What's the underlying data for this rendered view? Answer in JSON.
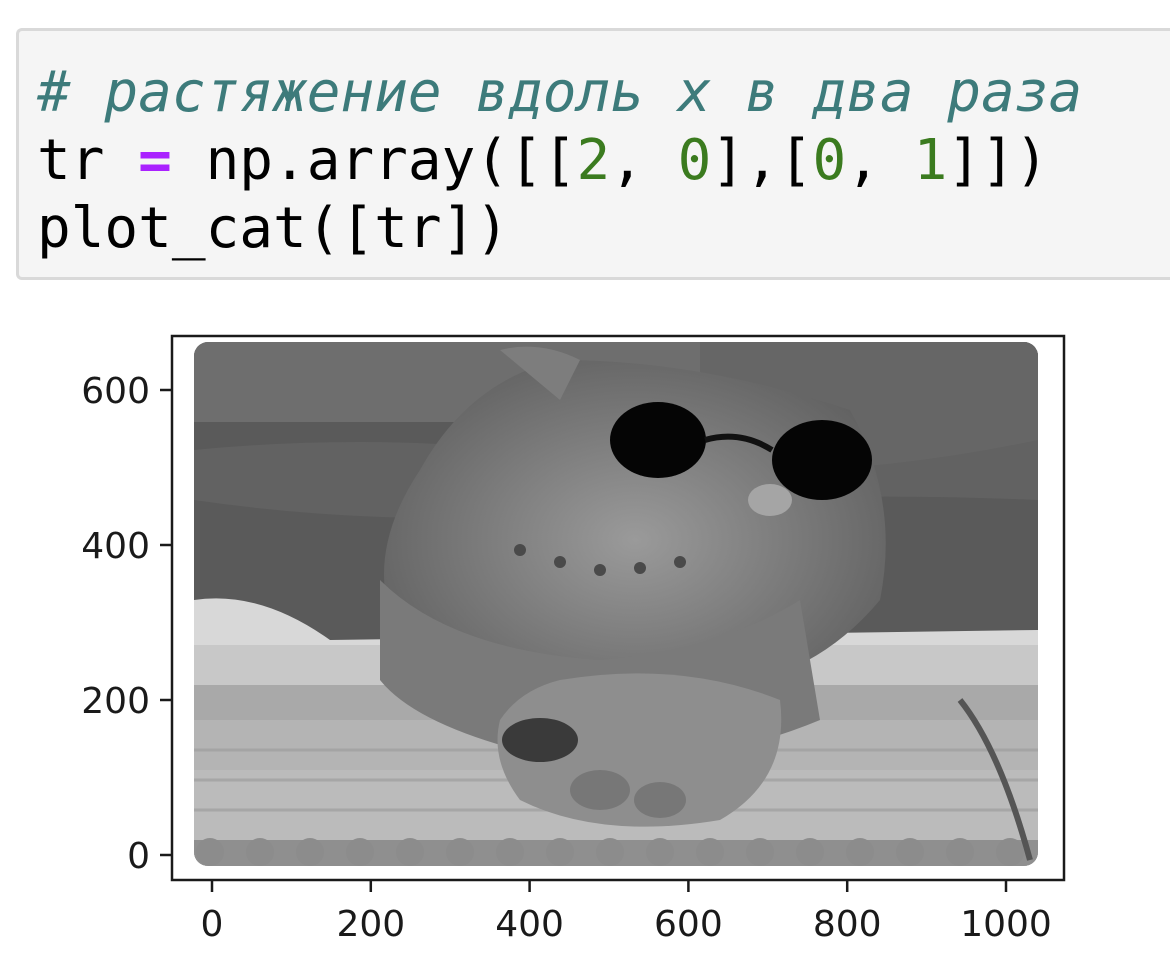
{
  "code_cell": {
    "lines": [
      [
        {
          "text": "# растяжение вдоль x в два раза",
          "kind": "comment"
        }
      ],
      [
        {
          "text": "tr ",
          "kind": "plain"
        },
        {
          "text": "=",
          "kind": "op"
        },
        {
          "text": " np.array([[",
          "kind": "plain"
        },
        {
          "text": "2",
          "kind": "num"
        },
        {
          "text": ", ",
          "kind": "plain"
        },
        {
          "text": "0",
          "kind": "num"
        },
        {
          "text": "],[",
          "kind": "plain"
        },
        {
          "text": "0",
          "kind": "num"
        },
        {
          "text": ", ",
          "kind": "plain"
        },
        {
          "text": "1",
          "kind": "num"
        },
        {
          "text": "]])",
          "kind": "plain"
        }
      ],
      [
        {
          "text": "plot_cat([tr])",
          "kind": "plain"
        }
      ]
    ]
  },
  "output_plot": {
    "image_description_icon": "grayscale-cat-with-sunglasses-image",
    "x_ticks": [
      "0",
      "200",
      "400",
      "600",
      "800",
      "1000"
    ],
    "y_ticks": [
      "0",
      "200",
      "400",
      "600"
    ]
  }
}
